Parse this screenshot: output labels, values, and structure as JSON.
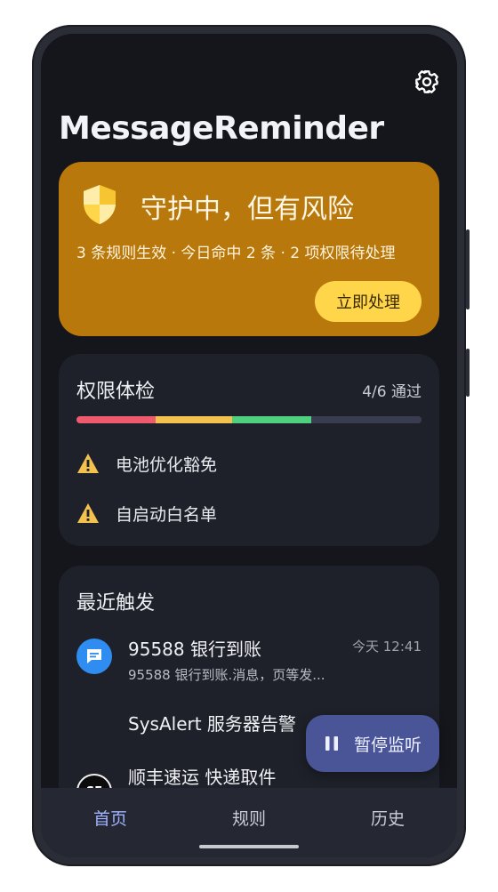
{
  "app": {
    "title": "MessageReminder"
  },
  "status_card": {
    "title": "守护中，但有风险",
    "subtitle": "3 条规则生效 · 今日命中 2 条 · 2 项权限待处理",
    "action_label": "立即处理"
  },
  "permissions": {
    "title": "权限体检",
    "count": "4/6 通过",
    "progress_segments": [
      {
        "color": "#ef5a6f",
        "fraction": 0.23
      },
      {
        "color": "#f2c14e",
        "fraction": 0.22
      },
      {
        "color": "#4fd07f",
        "fraction": 0.23
      },
      {
        "color": "#3a3d4f",
        "fraction": 0.32
      }
    ],
    "warnings": [
      {
        "label": "电池优化豁免",
        "icon": "warning-icon"
      },
      {
        "label": "自启动白名单",
        "icon": "warning-icon"
      }
    ]
  },
  "recent": {
    "title": "最近触发",
    "items": [
      {
        "title": "95588 银行到账",
        "preview": "95588 银行到账.消息，页等发...",
        "time": "今天 12:41",
        "icon": "message-icon",
        "icon_color": "#2f8cf0"
      },
      {
        "title": "SysAlert 服务器告警",
        "preview": "",
        "time": "",
        "icon": "",
        "icon_color": ""
      },
      {
        "title": "顺丰速运 快递取件",
        "preview": "",
        "time": "",
        "icon": "sf-logo-icon",
        "icon_color": "#111111"
      }
    ]
  },
  "fab": {
    "label": "暂停监听",
    "icon": "pause-icon"
  },
  "nav": {
    "items": [
      {
        "label": "首页",
        "active": true
      },
      {
        "label": "规则",
        "active": false
      },
      {
        "label": "历史",
        "active": false
      }
    ]
  },
  "colors": {
    "accent": "#9fb3ff",
    "status_card": "#b8780c",
    "action_button": "#ffd54a",
    "fab": "#4a5597"
  }
}
